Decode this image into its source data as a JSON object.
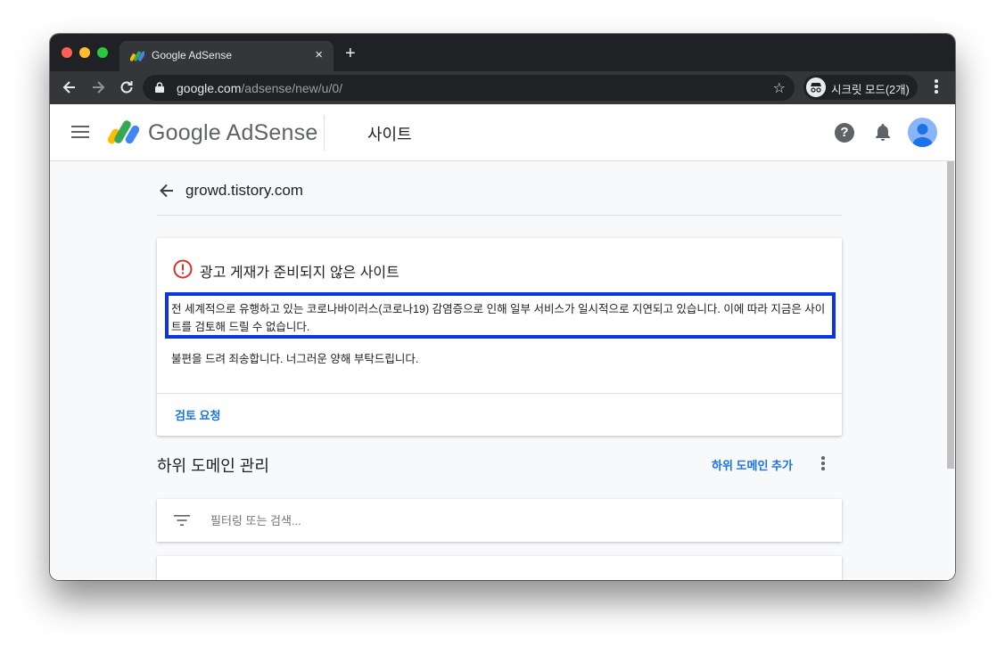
{
  "browser": {
    "tab_title": "Google AdSense",
    "tab_close": "×",
    "new_tab": "+",
    "url_host": "google.com",
    "url_path": "/adsense/new/u/0/",
    "incognito_label": "시크릿 모드(2개)",
    "icons": [
      "back-icon",
      "forward-icon",
      "reload-icon",
      "lock-icon",
      "star-icon",
      "incognito-icon",
      "more-icon"
    ]
  },
  "header": {
    "logo_text": "Google AdSense",
    "section": "사이트",
    "help": "?"
  },
  "site": {
    "name": "growd.tistory.com"
  },
  "alert_card": {
    "title": "광고 게재가 준비되지 않은 사이트",
    "message_highlighted": "전 세계적으로 유행하고 있는 코로나바이러스(코로나19) 감염증으로 인해 일부 서비스가 일시적으로 지연되고 있습니다. 이에 따라 지금은 사이트를 검토해 드릴 수 없습니다.",
    "message_apology": "불편을 드려 죄송합니다. 너그러운 양해 부탁드립니다.",
    "action_label": "검토 요청"
  },
  "subdomain": {
    "title": "하위 도메인 관리",
    "add_label": "하위 도메인 추가",
    "filter_placeholder": "필터링 또는 검색..."
  },
  "colors": {
    "accent": "#1a73e8",
    "warning": "#d93025",
    "highlight_border": "#0b34e6"
  }
}
